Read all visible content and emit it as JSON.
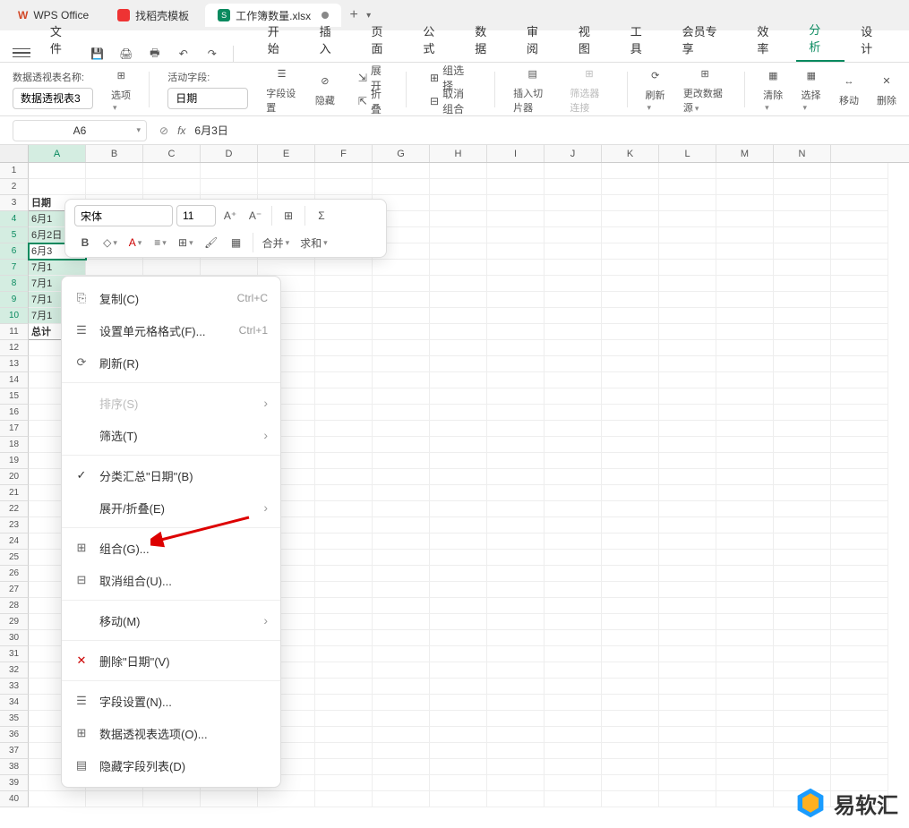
{
  "tabs": {
    "app": "WPS Office",
    "template": "找稻壳模板",
    "doc": "工作簿数量.xlsx",
    "sheet_badge": "S"
  },
  "file_menu": "文件",
  "menus": [
    "开始",
    "插入",
    "页面",
    "公式",
    "数据",
    "审阅",
    "视图",
    "工具",
    "会员专享",
    "效率",
    "分析",
    "设计"
  ],
  "ribbon": {
    "pivot_name_label": "数据透视表名称:",
    "pivot_name": "数据透视表3",
    "options": "选项",
    "active_field_label": "活动字段:",
    "active_field": "日期",
    "field_settings": "字段设置",
    "hide": "隐藏",
    "expand": "展开",
    "collapse": "折叠",
    "group_sel": "组选择",
    "ungroup": "取消组合",
    "insert_slicer": "插入切片器",
    "filter_conn": "筛选器连接",
    "refresh": "刷新",
    "change_source": "更改数据源",
    "clear": "清除",
    "select": "选择",
    "move": "移动",
    "delete": "删除"
  },
  "formula_bar": {
    "namebox": "A6",
    "fx": "fx",
    "value": "6月3日"
  },
  "columns": [
    "A",
    "B",
    "C",
    "D",
    "E",
    "F",
    "G",
    "H",
    "I",
    "J",
    "K",
    "L",
    "M",
    "N"
  ],
  "rows": {
    "header": "日期",
    "data": [
      "6月1",
      "6月2日",
      "6月3",
      "7月1",
      "7月1",
      "7月1",
      "7月1"
    ],
    "total": "总计"
  },
  "mini": {
    "font": "宋体",
    "size": "11",
    "merge": "合并",
    "sum": "求和"
  },
  "context": {
    "copy": "复制(C)",
    "copy_key": "Ctrl+C",
    "format": "设置单元格格式(F)...",
    "format_key": "Ctrl+1",
    "refresh": "刷新(R)",
    "sort": "排序(S)",
    "filter": "筛选(T)",
    "subtotal": "分类汇总\"日期\"(B)",
    "expand": "展开/折叠(E)",
    "group": "组合(G)...",
    "ungroup": "取消组合(U)...",
    "move": "移动(M)",
    "delete": "删除\"日期\"(V)",
    "field_settings": "字段设置(N)...",
    "pivot_options": "数据透视表选项(O)...",
    "hide_fieldlist": "隐藏字段列表(D)"
  },
  "watermark": "易软汇"
}
